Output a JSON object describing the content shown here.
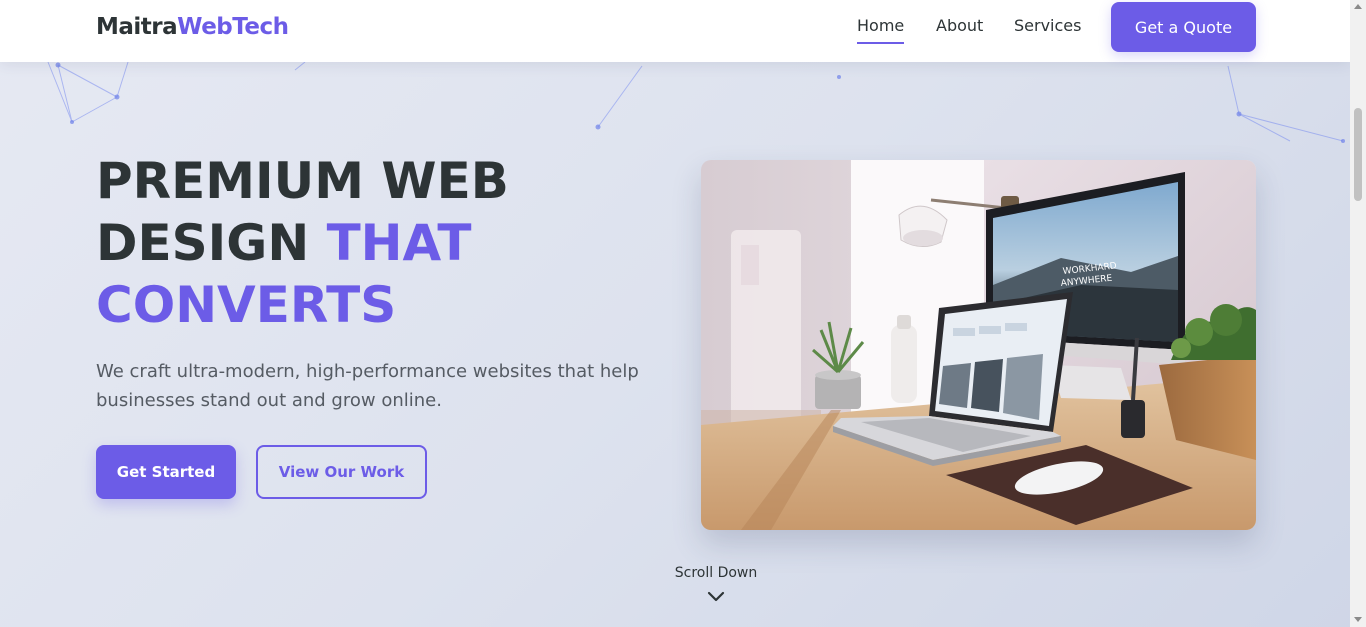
{
  "header": {
    "brand_part1": "Maitra",
    "brand_part2": "WebTech",
    "nav": [
      {
        "label": "Home",
        "active": true
      },
      {
        "label": "About",
        "active": false
      },
      {
        "label": "Services",
        "active": false
      }
    ],
    "cta_label": "Get a Quote"
  },
  "hero": {
    "title_line1": "PREMIUM WEB",
    "title_line2_dark": "DESIGN ",
    "title_line2_accent": "THAT",
    "title_line3": "CONVERTS",
    "subtitle": "We craft ultra-modern, high-performance websites that help businesses stand out and grow online.",
    "primary_button": "Get Started",
    "secondary_button": "View Our Work",
    "monitor_text_1": "WORKHARD",
    "monitor_text_2": "ANYWHERE"
  },
  "scroll": {
    "label": "Scroll Down",
    "icon": "chevron-down-icon"
  },
  "colors": {
    "accent": "#6c5ce7",
    "text_dark": "#2d3436",
    "text_muted": "#555b63",
    "background": "#dde2ee"
  }
}
